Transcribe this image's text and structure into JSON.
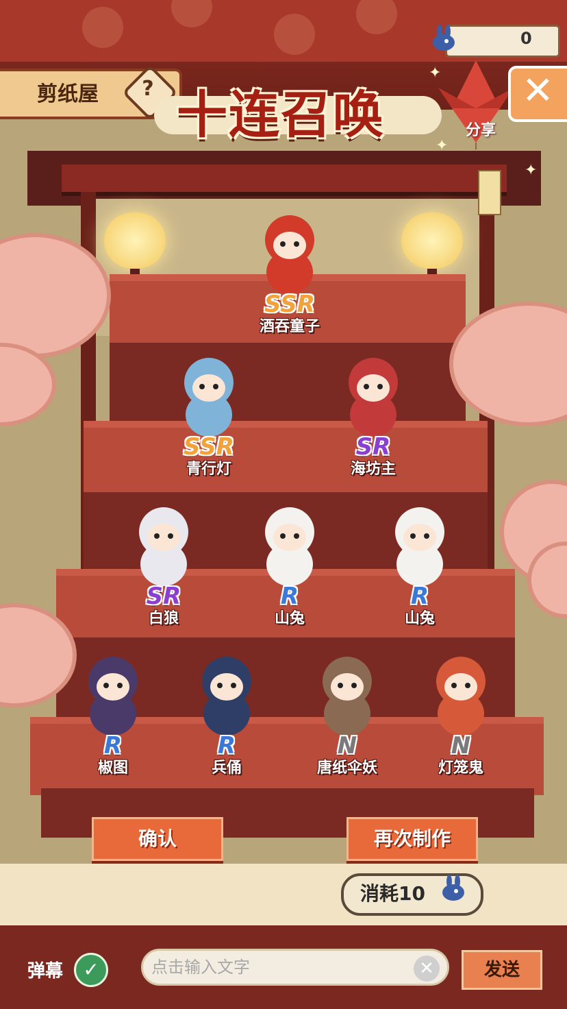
{
  "header": {
    "house_label": "剪纸屋",
    "help_symbol": "?",
    "title": "十连召唤",
    "currency_value": "0",
    "share_label": "分享",
    "close_symbol": "✕"
  },
  "characters": [
    {
      "name": "酒吞童子",
      "rarity": "SSR"
    },
    {
      "name": "青行灯",
      "rarity": "SSR"
    },
    {
      "name": "海坊主",
      "rarity": "SR"
    },
    {
      "name": "白狼",
      "rarity": "SR"
    },
    {
      "name": "山兔",
      "rarity": "R"
    },
    {
      "name": "山兔",
      "rarity": "R"
    },
    {
      "name": "椒图",
      "rarity": "R"
    },
    {
      "name": "兵俑",
      "rarity": "R"
    },
    {
      "name": "唐纸伞妖",
      "rarity": "N"
    },
    {
      "name": "灯笼鬼",
      "rarity": "N"
    }
  ],
  "actions": {
    "confirm_label": "确认",
    "again_label": "再次制作",
    "cost_label": "消耗10"
  },
  "footer": {
    "danmu_label": "弹幕",
    "danmu_enabled": true,
    "input_placeholder": "点击输入文字",
    "send_label": "发送"
  },
  "colors": {
    "rarity_ssr": "#f2a23a",
    "rarity_sr": "#8b3fd0",
    "rarity_r": "#3a79d8",
    "rarity_n": "#7a7a7a",
    "accent": "#e86a3a"
  }
}
